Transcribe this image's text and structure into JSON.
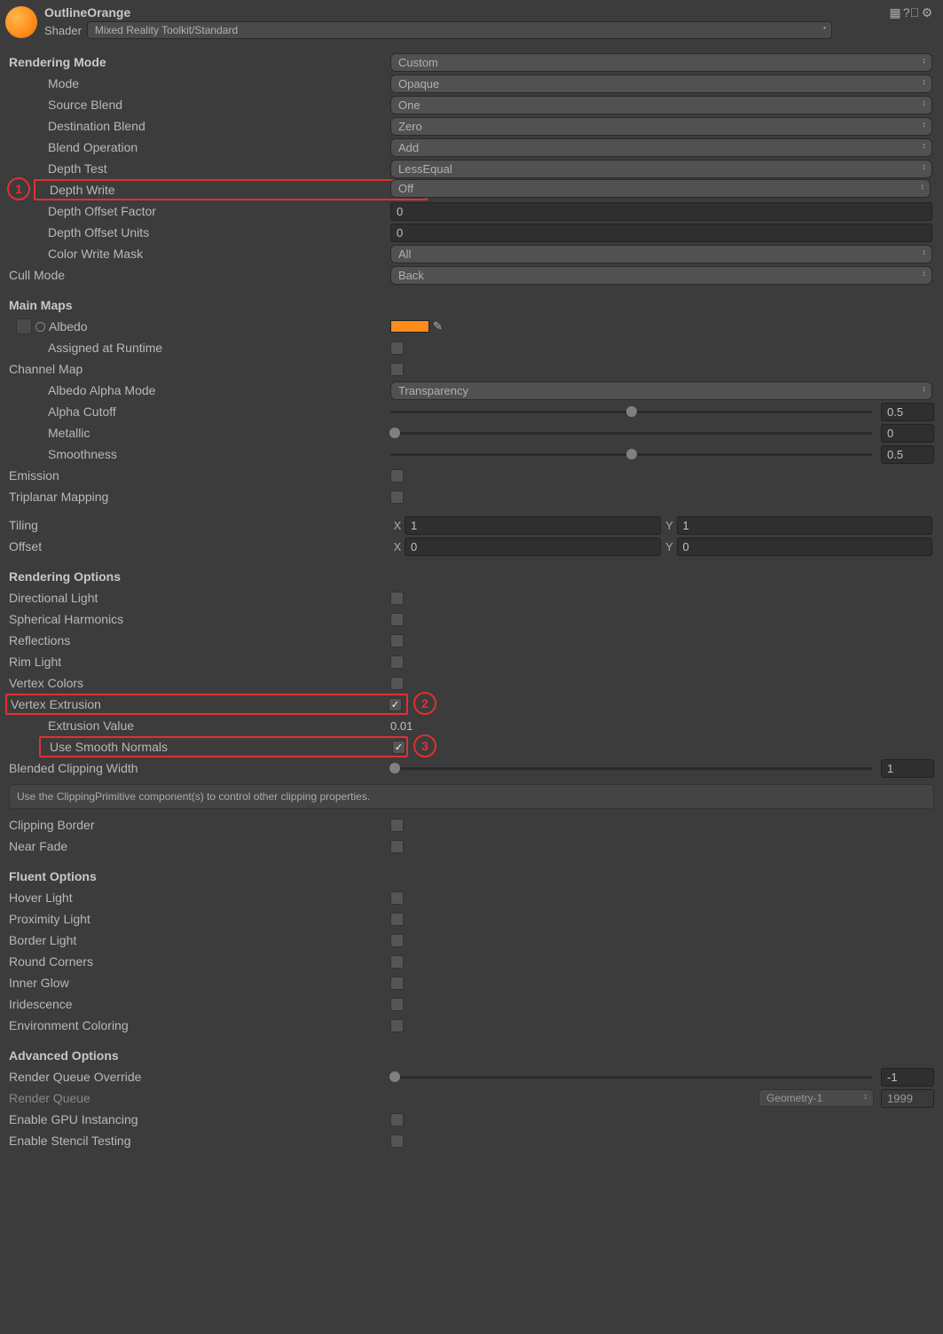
{
  "header": {
    "title": "OutlineOrange",
    "shader_label": "Shader",
    "shader_value": "Mixed Reality Toolkit/Standard"
  },
  "rendering_mode": {
    "title": "Rendering Mode",
    "value": "Custom",
    "mode": "Mode",
    "mode_v": "Opaque",
    "src_blend": "Source Blend",
    "src_blend_v": "One",
    "dst_blend": "Destination Blend",
    "dst_blend_v": "Zero",
    "blend_op": "Blend Operation",
    "blend_op_v": "Add",
    "depth_test": "Depth Test",
    "depth_test_v": "LessEqual",
    "depth_write": "Depth Write",
    "depth_write_v": "Off",
    "depth_off_f": "Depth Offset Factor",
    "depth_off_f_v": "0",
    "depth_off_u": "Depth Offset Units",
    "depth_off_u_v": "0",
    "cw_mask": "Color Write Mask",
    "cw_mask_v": "All",
    "cull": "Cull Mode",
    "cull_v": "Back"
  },
  "main_maps": {
    "title": "Main Maps",
    "albedo": "Albedo",
    "albedo_color": "#ff8c1a",
    "assigned_rt": "Assigned at Runtime",
    "channel_map": "Channel Map",
    "albedo_alpha": "Albedo Alpha Mode",
    "albedo_alpha_v": "Transparency",
    "alpha_cutoff": "Alpha Cutoff",
    "alpha_cutoff_v": "0.5",
    "metallic": "Metallic",
    "metallic_v": "0",
    "smoothness": "Smoothness",
    "smoothness_v": "0.5",
    "emission": "Emission",
    "triplanar": "Triplanar Mapping",
    "tiling": "Tiling",
    "tiling_x": "1",
    "tiling_y": "1",
    "offset": "Offset",
    "offset_x": "0",
    "offset_y": "0"
  },
  "rendering_options": {
    "title": "Rendering Options",
    "dir_light": "Directional Light",
    "sph_harm": "Spherical Harmonics",
    "reflections": "Reflections",
    "rim_light": "Rim Light",
    "vtx_colors": "Vertex Colors",
    "vtx_extrusion": "Vertex Extrusion",
    "extrusion_val": "Extrusion Value",
    "extrusion_val_v": "0.01",
    "smooth_normals": "Use Smooth Normals",
    "blended_clip": "Blended Clipping Width",
    "blended_clip_v": "1",
    "clip_note": "Use the ClippingPrimitive component(s) to control other clipping properties.",
    "clip_border": "Clipping Border",
    "near_fade": "Near Fade"
  },
  "fluent": {
    "title": "Fluent Options",
    "hover": "Hover Light",
    "proximity": "Proximity Light",
    "border": "Border Light",
    "round": "Round Corners",
    "inner": "Inner Glow",
    "irid": "Iridescence",
    "env": "Environment Coloring"
  },
  "advanced": {
    "title": "Advanced Options",
    "rq_override": "Render Queue Override",
    "rq_override_v": "-1",
    "rq": "Render Queue",
    "rq_dd": "Geometry-1",
    "rq_v": "1999",
    "gpu_inst": "Enable GPU Instancing",
    "stencil": "Enable Stencil Testing"
  },
  "annotations": {
    "a1": "1",
    "a2": "2",
    "a3": "3"
  }
}
